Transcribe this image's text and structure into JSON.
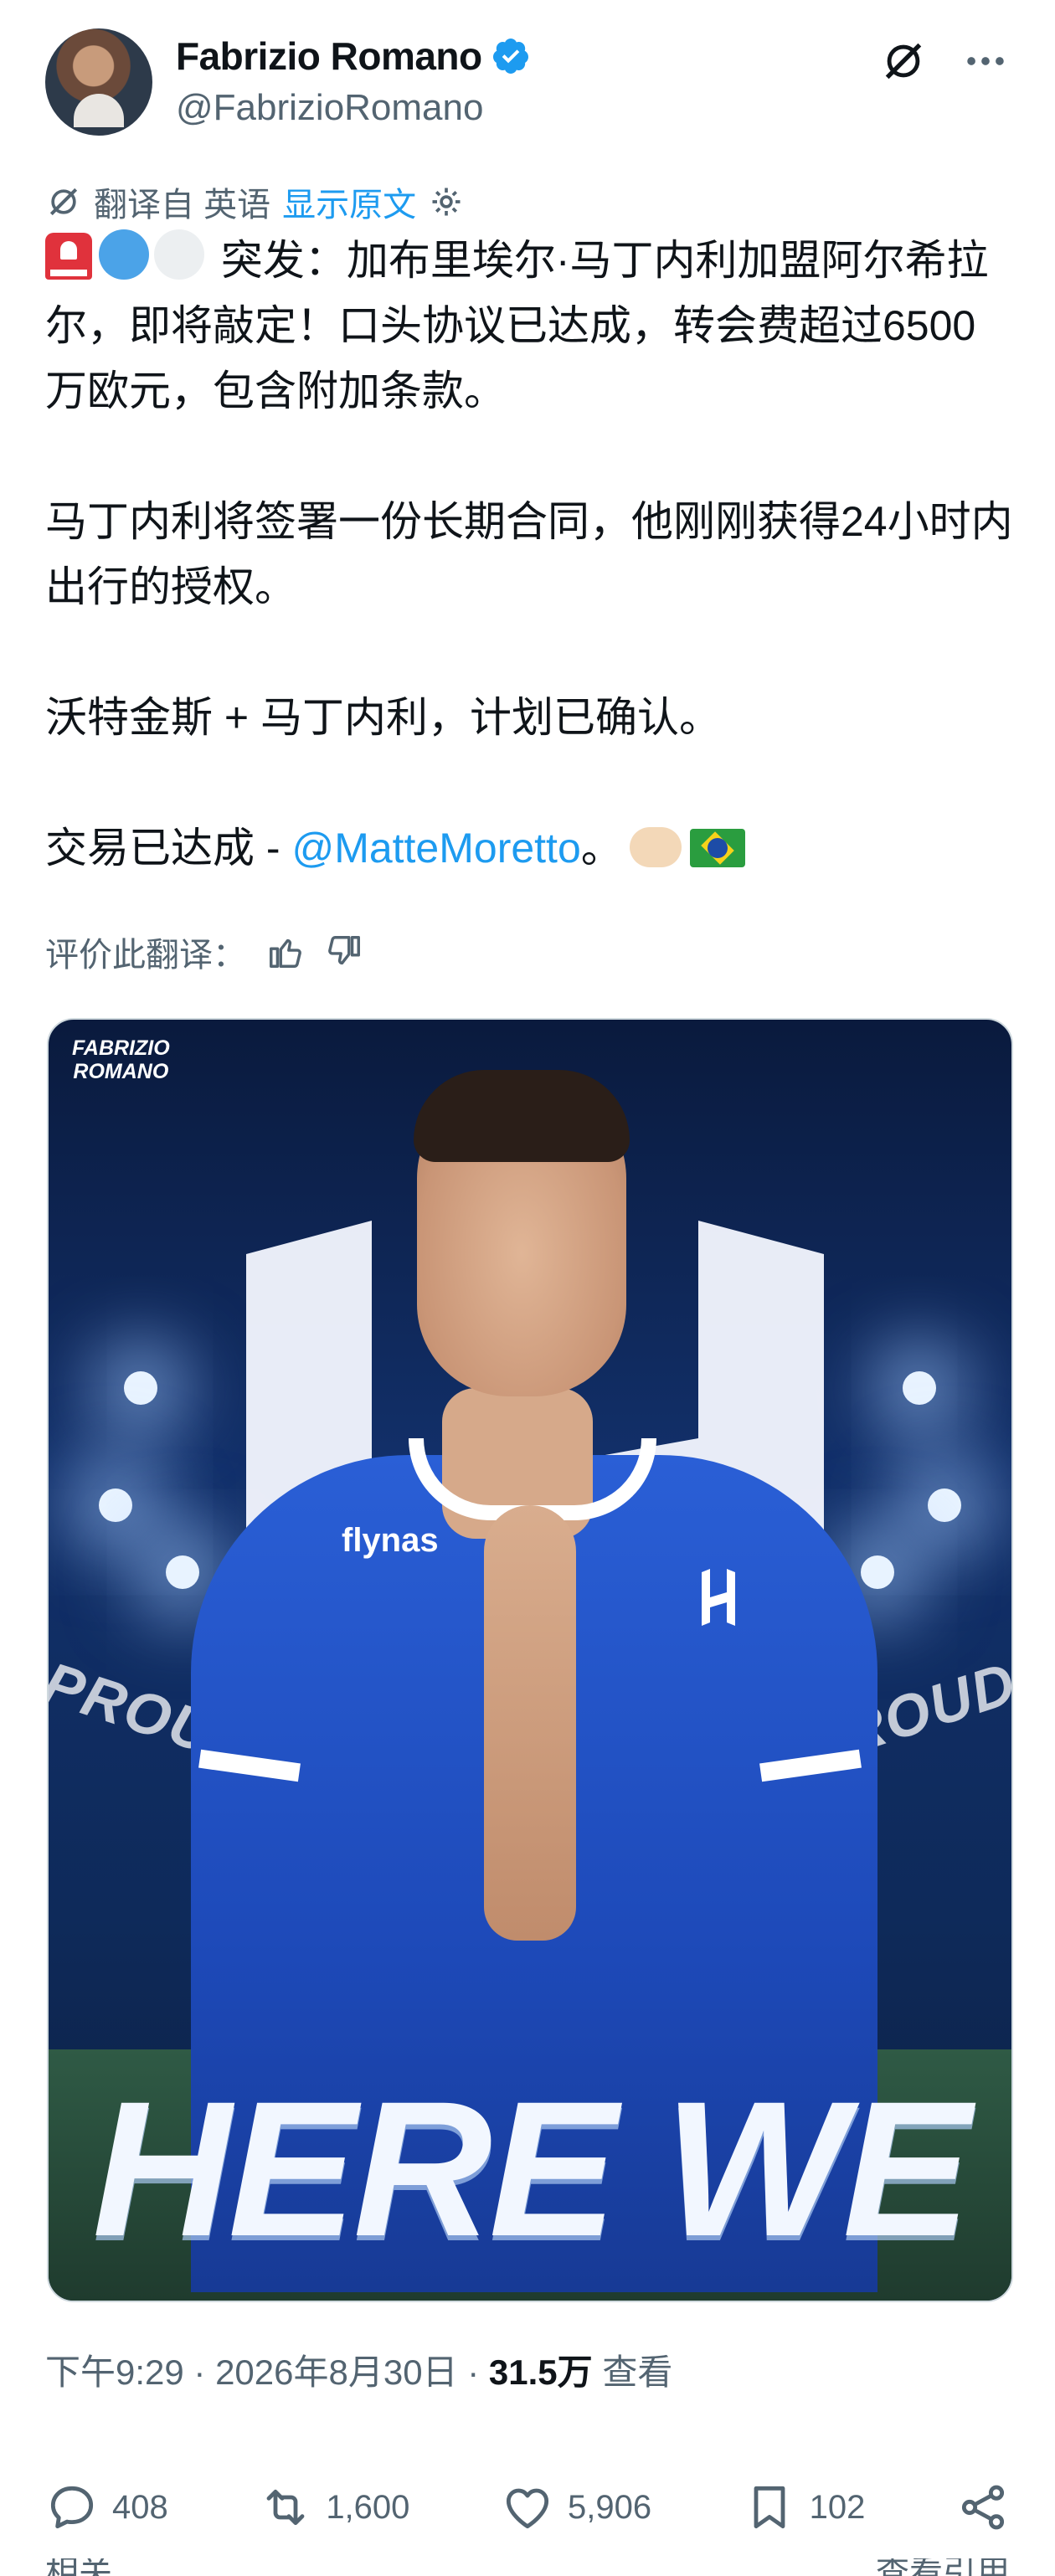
{
  "author": {
    "display_name": "Fabrizio Romano",
    "handle": "@FabrizioRomano",
    "verified": true
  },
  "header_icons": [
    "grok-icon",
    "more-icon"
  ],
  "translation": {
    "translated_from": "翻译自 英语",
    "show_original": "显示原文"
  },
  "tweet": {
    "p1": "突发：加布里埃尔·马丁内利加盟阿尔希拉尔，即将敲定！口头协议已达成，转会费超过6500万欧元，包含附加条款。",
    "p2": "马丁内利将签署一份长期合同，他刚刚获得24小时内出行的授权。",
    "p3": "沃特金斯 + 马丁内利，计划已确认。",
    "p4_prefix": "交易已达成 - ",
    "p4_mention": "@MatteMoretto",
    "p4_suffix": "。"
  },
  "rate_translation": "评价此翻译：",
  "media": {
    "brand_line1": "FABRIZIO",
    "brand_line2": "ROMANO",
    "sponsor": "flynas",
    "banner_left": "PROUD",
    "banner_right": "PROUD",
    "headline": "HERE WE GO"
  },
  "meta": {
    "time": "下午9:29",
    "date": "2026年8月30日",
    "views": "31.5万",
    "views_label": "查看"
  },
  "actions": {
    "replies": "408",
    "reposts": "1,600",
    "likes": "5,906",
    "bookmarks": "102"
  },
  "partial_bottom": {
    "left": "相关",
    "right": "查看引用"
  },
  "colors": {
    "accent": "#1d9bf0",
    "secondary_text": "#536471",
    "primary_text": "#0f1419"
  }
}
